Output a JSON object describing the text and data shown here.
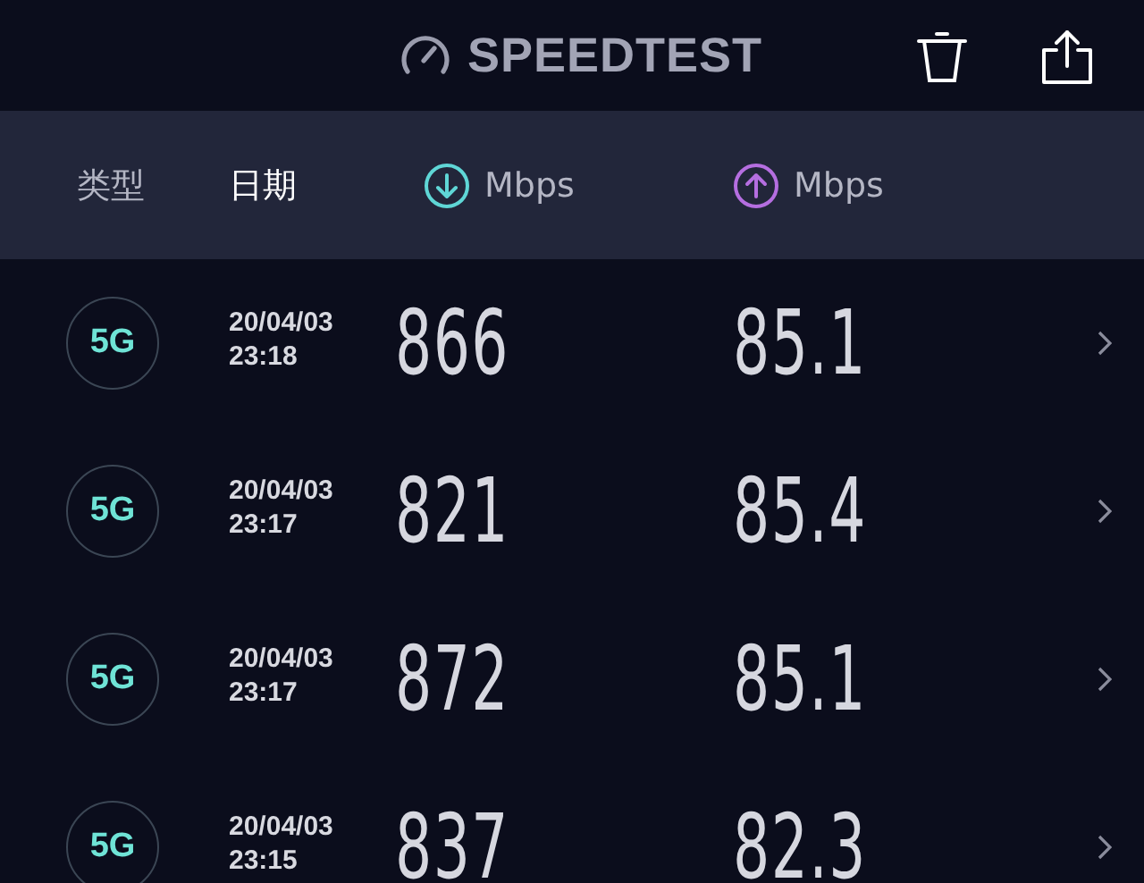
{
  "header": {
    "title": "SPEEDTEST"
  },
  "columns": [
    {
      "kind": "text",
      "label": "类型",
      "selected": false
    },
    {
      "kind": "text",
      "label": "日期",
      "selected": true
    },
    {
      "kind": "download",
      "label": "Mbps",
      "selected": false
    },
    {
      "kind": "upload",
      "label": "Mbps",
      "selected": false
    }
  ],
  "results": [
    {
      "type": "5G",
      "date": "20/04/03",
      "time": "23:18",
      "download": "866",
      "upload": "85.1"
    },
    {
      "type": "5G",
      "date": "20/04/03",
      "time": "23:17",
      "download": "821",
      "upload": "85.4"
    },
    {
      "type": "5G",
      "date": "20/04/03",
      "time": "23:17",
      "download": "872",
      "upload": "85.1"
    },
    {
      "type": "5G",
      "date": "20/04/03",
      "time": "23:15",
      "download": "837",
      "upload": "82.3"
    }
  ]
}
